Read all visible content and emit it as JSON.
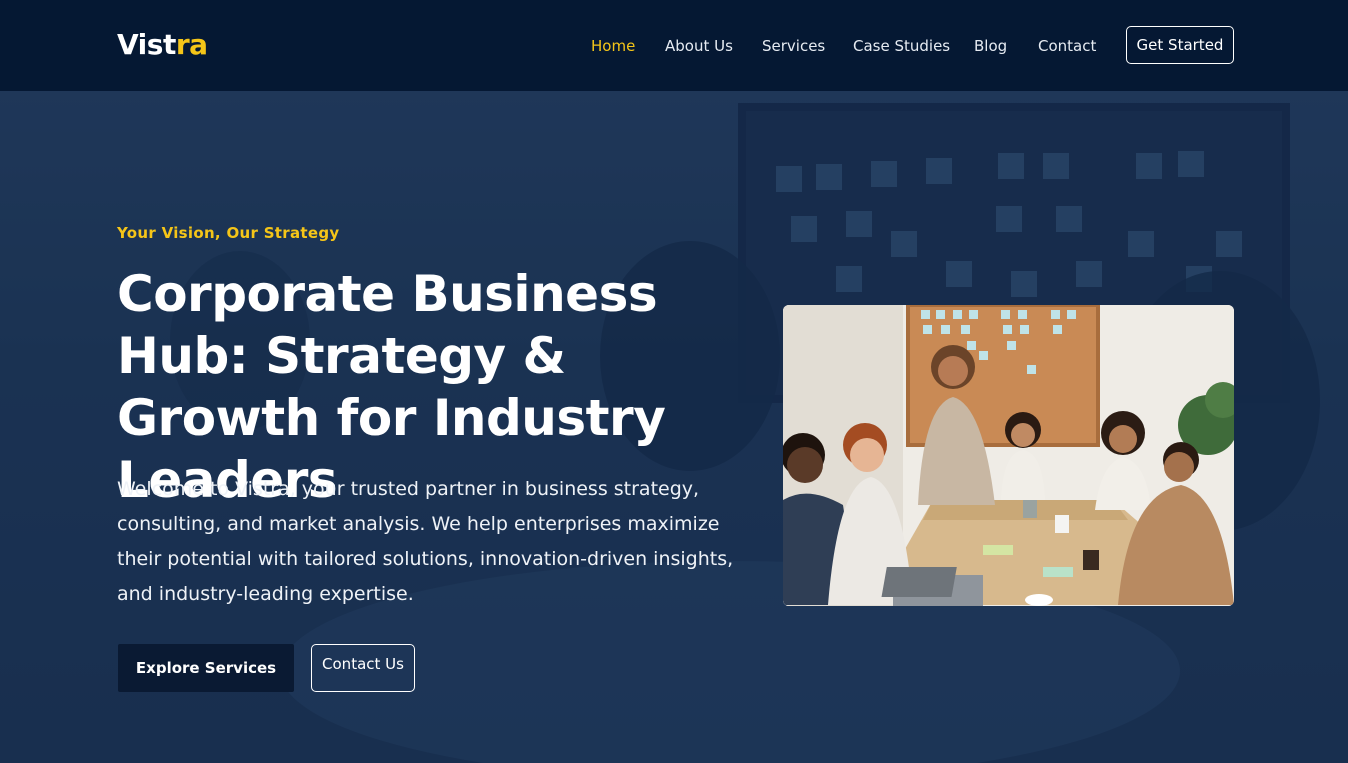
{
  "brand": {
    "logo_part1": "Vist",
    "logo_part2": "ra"
  },
  "nav": {
    "items": [
      {
        "label": "Home",
        "active": true
      },
      {
        "label": "About Us"
      },
      {
        "label": "Services"
      },
      {
        "label": "Case Studies"
      },
      {
        "label": "Blog"
      },
      {
        "label": "Contact"
      }
    ],
    "cta_label": "Get Started"
  },
  "hero": {
    "tagline": "Your Vision, Our Strategy",
    "title": "Corporate Business Hub: Strategy & Growth for Industry Leaders",
    "description": "Welcome to Vistra, your trusted partner in business strategy, consulting, and market analysis. We help enterprises maximize their potential with tailored solutions, innovation-driven insights, and industry-leading expertise.",
    "primary_button": "Explore Services",
    "secondary_button": "Contact Us"
  },
  "colors": {
    "accent": "#f5c518",
    "header_bg": "#051833",
    "button_dark": "#0a1a33"
  }
}
